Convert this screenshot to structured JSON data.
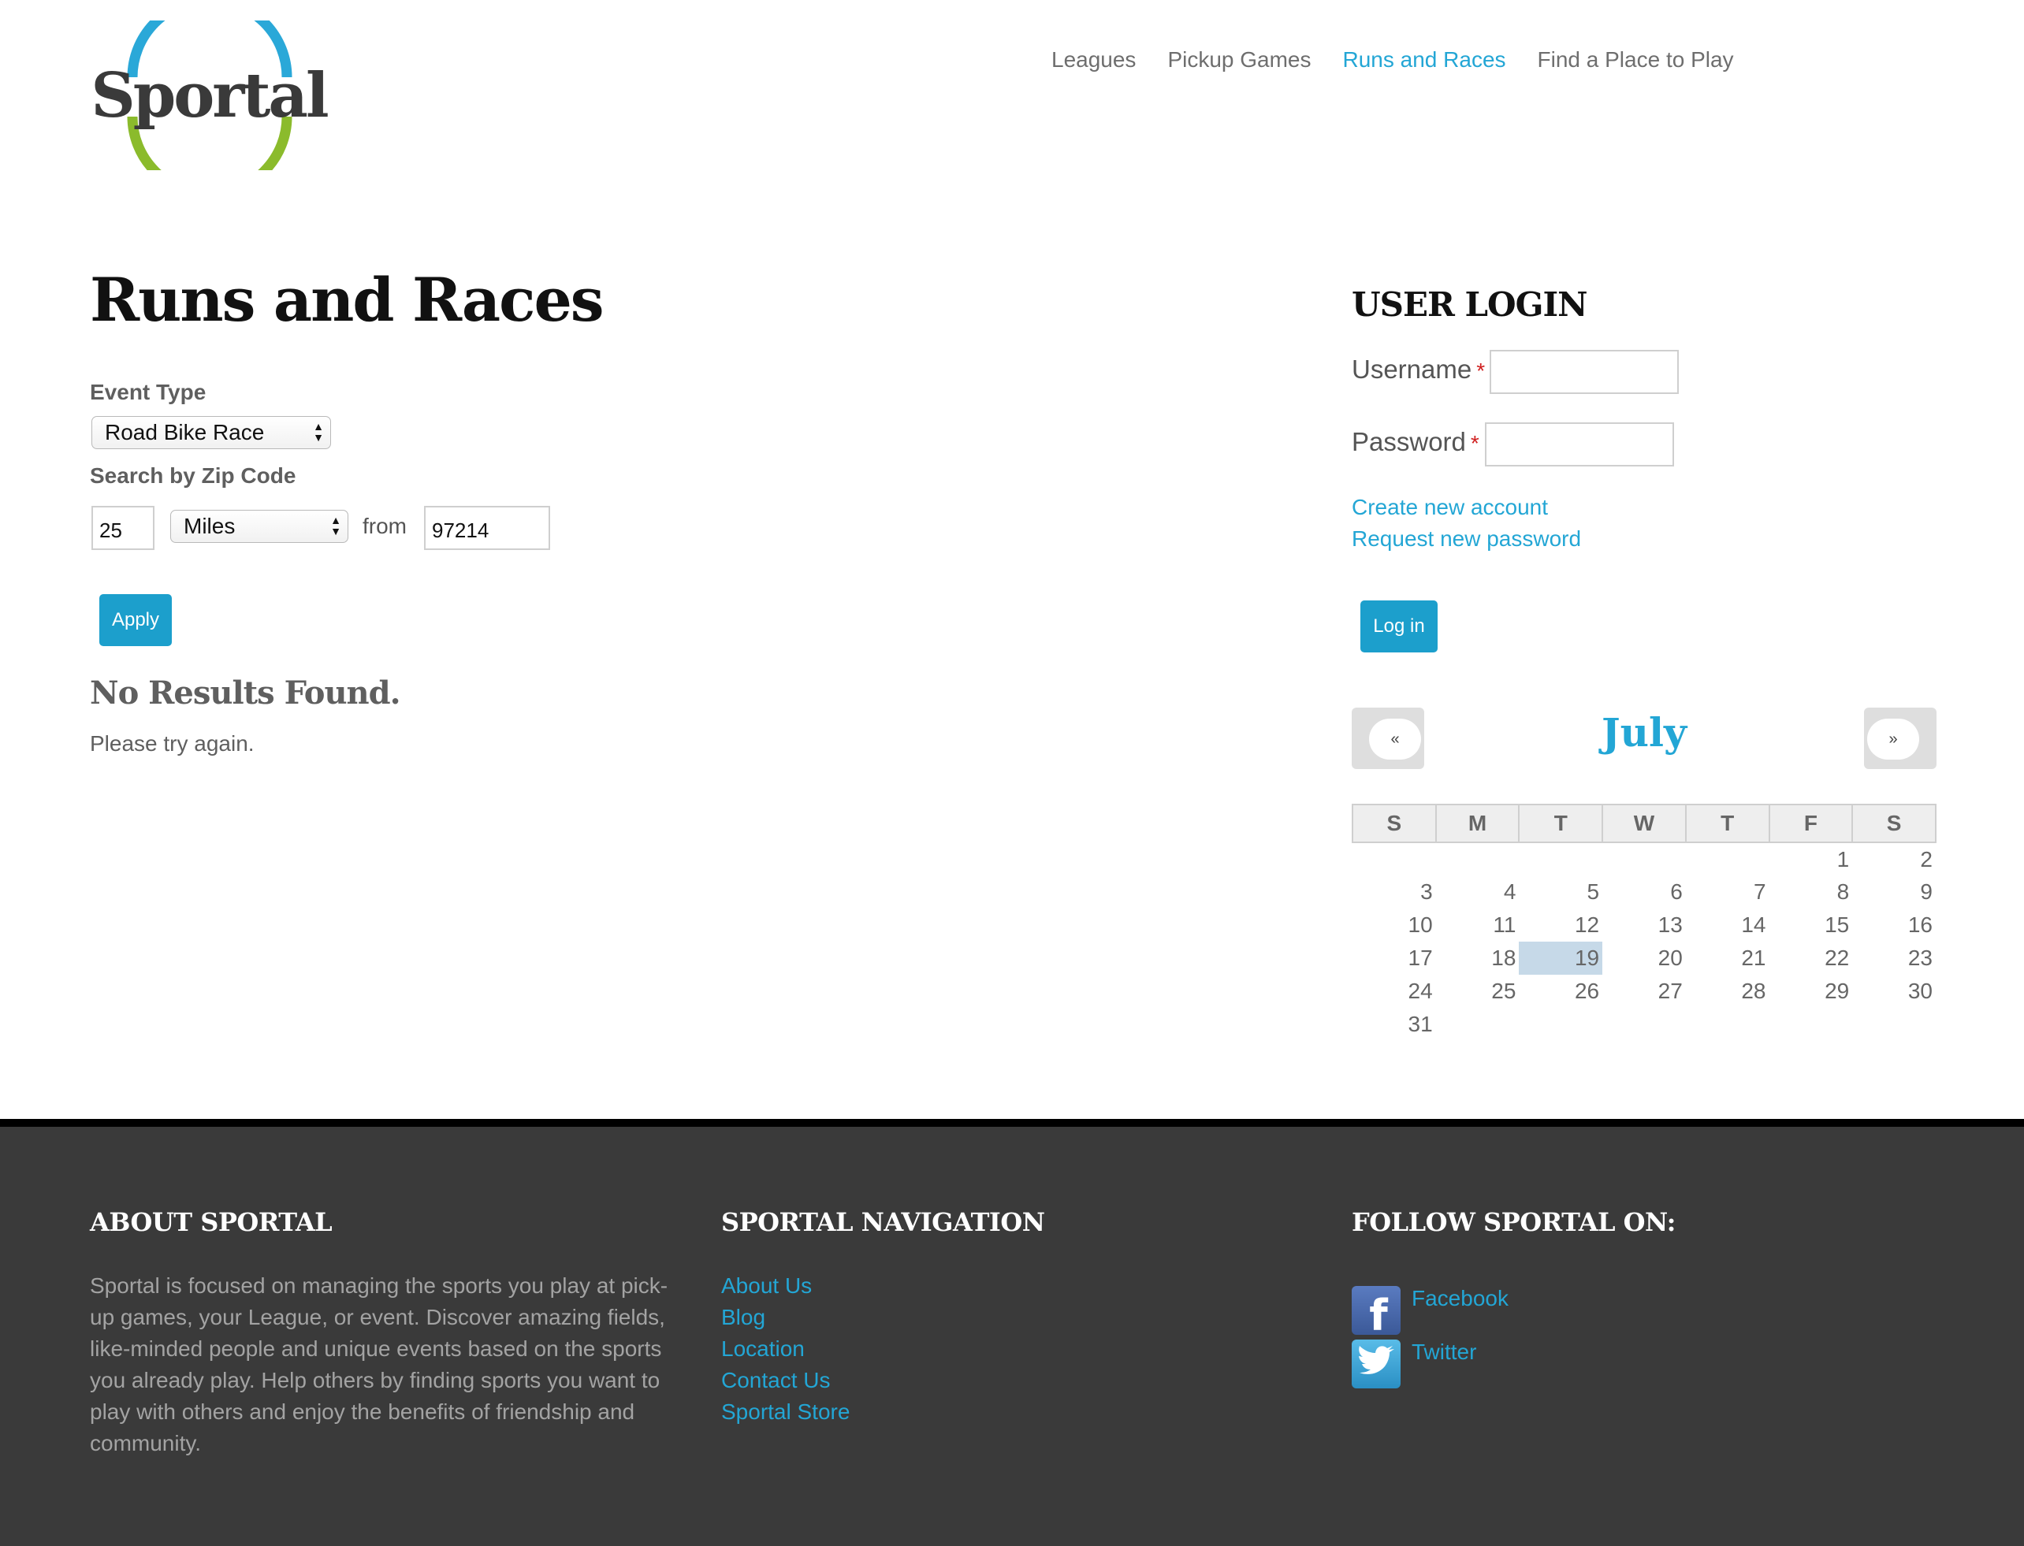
{
  "brand": {
    "logo_text": "Sportal",
    "ring_blue": "#2aa8d8",
    "ring_green": "#8bbb2c",
    "accent": "#23a6d5"
  },
  "nav": {
    "items": [
      {
        "label": "Leagues"
      },
      {
        "label": "Pickup Games"
      },
      {
        "label": "Runs and Races"
      },
      {
        "label": "Find a Place to Play"
      }
    ]
  },
  "main": {
    "title": "Runs and Races",
    "event_type_label": "Event Type",
    "event_type_value": "Road Bike Race",
    "zip_label": "Search by Zip Code",
    "distance_value": "25",
    "unit_value": "Miles",
    "from_label": "from",
    "zip_value": "97214",
    "apply_label": "Apply",
    "no_results_title": "No Results Found.",
    "no_results_text": "Please try again."
  },
  "login": {
    "title": "USER LOGIN",
    "username_label": "Username",
    "password_label": "Password",
    "required_mark": "*",
    "create_account": "Create new account",
    "request_password": "Request new password",
    "login_button": "Log in"
  },
  "calendar": {
    "prev": "«",
    "next": "»",
    "month": "July",
    "days": [
      "S",
      "M",
      "T",
      "W",
      "T",
      "F",
      "S"
    ],
    "today": "19",
    "weeks": [
      [
        "",
        "",
        "",
        "",
        "",
        "1",
        "2"
      ],
      [
        "3",
        "4",
        "5",
        "6",
        "7",
        "8",
        "9"
      ],
      [
        "10",
        "11",
        "12",
        "13",
        "14",
        "15",
        "16"
      ],
      [
        "17",
        "18",
        "19",
        "20",
        "21",
        "22",
        "23"
      ],
      [
        "24",
        "25",
        "26",
        "27",
        "28",
        "29",
        "30"
      ],
      [
        "31",
        "",
        "",
        "",
        "",
        "",
        ""
      ]
    ]
  },
  "footer": {
    "about_title": "ABOUT SPORTAL",
    "about_text": "Sportal is focused on managing the sports you play at pick-up games, your League, or event. Discover amazing fields, like-minded people and unique events based on the sports you already play. Help others by finding sports you want to play with others and enjoy the benefits of friendship and community.",
    "nav_title": "SPORTAL NAVIGATION",
    "nav_links": [
      "About Us",
      "Blog",
      "Location",
      "Contact Us",
      "Sportal Store"
    ],
    "follow_title": "FOLLOW SPORTAL ON:",
    "social": [
      {
        "label": "Facebook",
        "icon": "facebook-icon",
        "color": "#3b5998"
      },
      {
        "label": "Twitter",
        "icon": "twitter-icon",
        "color": "#2a9fd6"
      }
    ]
  }
}
